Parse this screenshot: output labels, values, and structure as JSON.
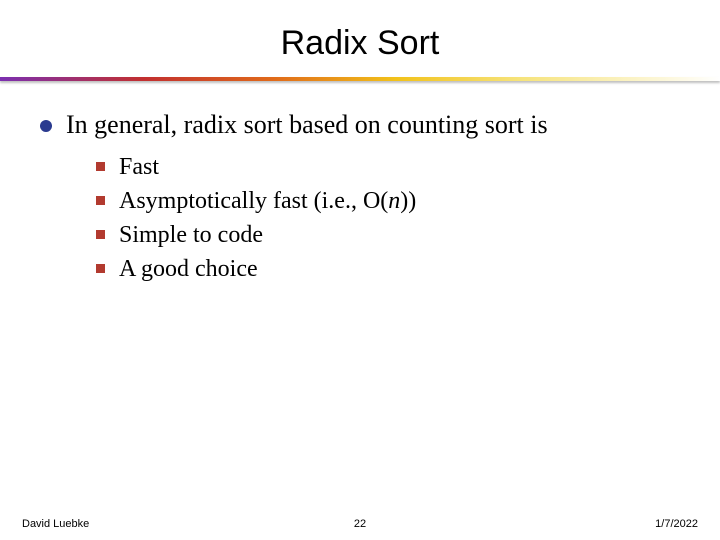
{
  "title": "Radix Sort",
  "bullet": {
    "text": "In general, radix sort based on counting sort is",
    "subs": [
      {
        "text": "Fast"
      },
      {
        "text_html": "Asymptotically fast (i.e., O(<span class=\"ital\">n</span>))"
      },
      {
        "text": "Simple to code"
      },
      {
        "text": "A good choice"
      }
    ]
  },
  "footer": {
    "author": "David Luebke",
    "page": "22",
    "date": "1/7/2022"
  }
}
